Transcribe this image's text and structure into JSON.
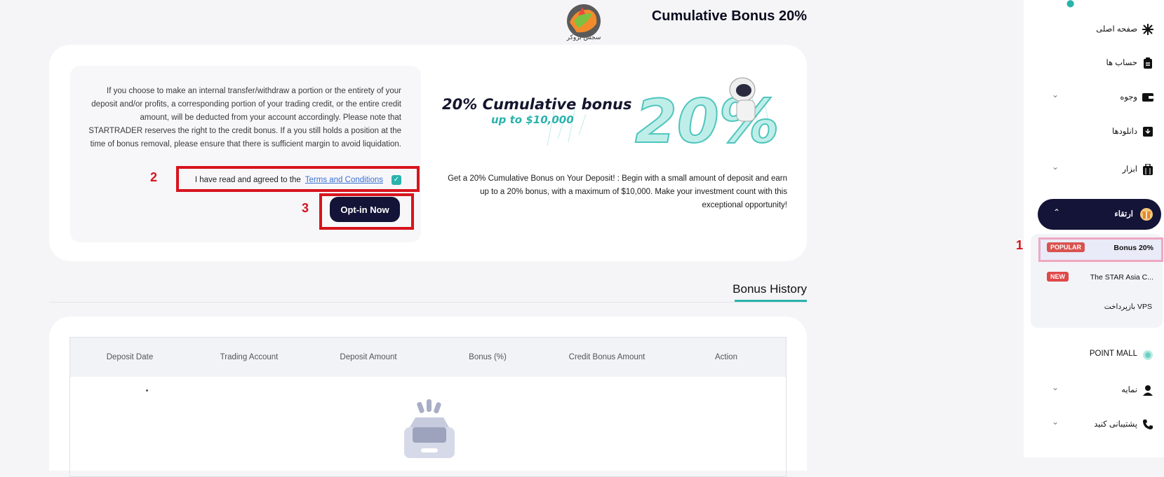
{
  "header": {
    "title": "Cumulative Bonus 20%",
    "logo_caption": "سجس بروکر"
  },
  "terms": {
    "notice": "If you choose to make an internal transfer/withdraw a portion or the entirety of your deposit and/or profits, a corresponding portion of your trading credit, or the entire credit amount, will be deducted from your account accordingly. Please note that STARTRADER reserves the right to the credit bonus. If a you still holds a position at the time of bonus removal, please ensure that there is sufficient margin to avoid liquidation.",
    "agree_text": "I have read and agreed to the",
    "terms_link": "Terms and Conditions",
    "agree_checked": true,
    "optin_label": "Opt-in Now"
  },
  "banner": {
    "headline": "20% Cumulative bonus",
    "subline": "up to $10,000",
    "big_number": "20%"
  },
  "promo_text": "Get a 20% Cumulative Bonus on Your Deposit! : Begin with a small amount of deposit and earn up to a 20% bonus, with a maximum of $10,000. Make your investment count with this exceptional opportunity!",
  "annotations": {
    "one": "1",
    "two": "2",
    "three": "3"
  },
  "history": {
    "title": "Bonus History",
    "columns": [
      "Deposit Date",
      "Trading Account",
      "Deposit Amount",
      "Bonus (%)",
      "Credit Bonus Amount",
      "Action"
    ],
    "empty_marker": "."
  },
  "sidebar": {
    "items": [
      {
        "label": "صفحه اصلی",
        "icon": "gear-icon"
      },
      {
        "label": "حساب ها",
        "icon": "clipboard-icon"
      },
      {
        "label": "وجوه",
        "icon": "wallet-icon"
      },
      {
        "label": "دانلودها",
        "icon": "download-icon"
      },
      {
        "label": "ابزار",
        "icon": "toolbox-icon"
      },
      {
        "label": "ارتقاء",
        "icon": "gift-icon"
      },
      {
        "label": "POINT MALL",
        "icon": "coin-icon"
      },
      {
        "label": "نمایه",
        "icon": "user-icon"
      },
      {
        "label": "پشتیبانی کنید",
        "icon": "phone-icon"
      }
    ],
    "sub_items": [
      {
        "label": "Bonus 20%",
        "badge": "POPULAR"
      },
      {
        "label": "The STAR Asia C...",
        "badge": "NEW"
      },
      {
        "label": "بازپرداخت VPS",
        "badge": ""
      }
    ]
  },
  "colors": {
    "accent": "#2ab3ad",
    "navy": "#141438",
    "annotation": "#d7141d"
  }
}
